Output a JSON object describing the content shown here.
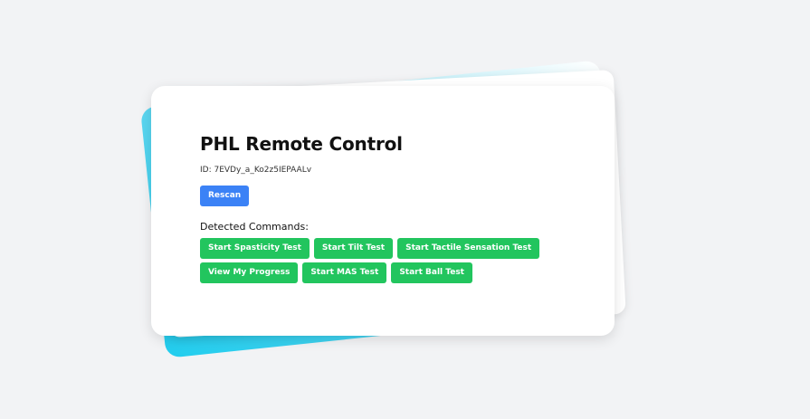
{
  "page": {
    "title": "PHL Remote Control",
    "id_label": "ID: 7EVDy_a_Ko2z5IEPAALv"
  },
  "actions": {
    "rescan_label": "Rescan"
  },
  "commands": {
    "heading": "Detected Commands:",
    "items": [
      {
        "label": "Start Spasticity Test"
      },
      {
        "label": "Start Tilt Test"
      },
      {
        "label": "Start Tactile Sensation Test"
      },
      {
        "label": "View My Progress"
      },
      {
        "label": "Start MAS Test"
      },
      {
        "label": "Start Ball Test"
      }
    ]
  },
  "colors": {
    "background": "#f2f3f5",
    "primary_button": "#3b82f6",
    "command_button": "#22c55e",
    "accent_gradient_start": "#22cdee"
  }
}
